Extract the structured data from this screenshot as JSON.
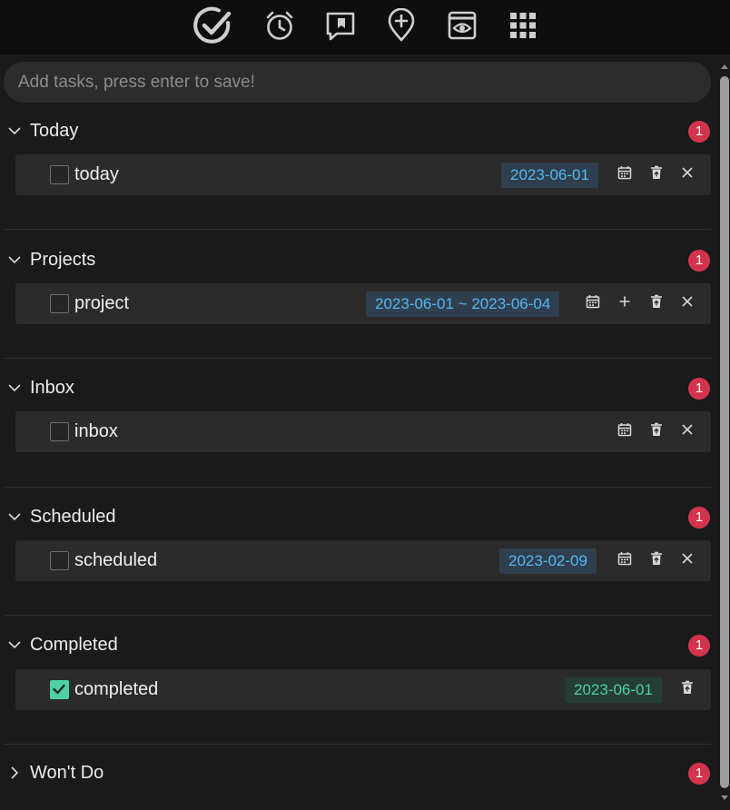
{
  "toolbar": {
    "icons": [
      "check-circle-icon",
      "alarm-clock-icon",
      "bookmark-message-icon",
      "map-pin-plus-icon",
      "eye-window-icon",
      "grid-apps-icon"
    ]
  },
  "input": {
    "placeholder": "Add tasks, press enter to save!",
    "value": ""
  },
  "colors": {
    "badge": "#d3344d",
    "date_blue": "#56b8f0",
    "date_green": "#4fd1a5",
    "checked": "#4fd1a5"
  },
  "sections": [
    {
      "title": "Today",
      "count": "1",
      "expanded": true,
      "task": {
        "text": "today",
        "date": "2023-06-01",
        "checked": false,
        "actions": [
          "calendar-icon",
          "trash-icon",
          "close-icon"
        ]
      }
    },
    {
      "title": "Projects",
      "count": "1",
      "expanded": true,
      "task": {
        "text": "project",
        "date": "2023-06-01 ~ 2023-06-04",
        "checked": false,
        "actions": [
          "calendar-icon",
          "plus-icon",
          "trash-icon",
          "close-icon"
        ]
      }
    },
    {
      "title": "Inbox",
      "count": "1",
      "expanded": true,
      "task": {
        "text": "inbox",
        "date": "",
        "checked": false,
        "actions": [
          "calendar-icon",
          "trash-icon",
          "close-icon"
        ]
      }
    },
    {
      "title": "Scheduled",
      "count": "1",
      "expanded": true,
      "task": {
        "text": "scheduled",
        "date": "2023-02-09",
        "checked": false,
        "actions": [
          "calendar-icon",
          "trash-icon",
          "close-icon"
        ]
      }
    },
    {
      "title": "Completed",
      "count": "1",
      "expanded": true,
      "task": {
        "text": "completed",
        "date": "2023-06-01",
        "checked": true,
        "actions": [
          "trash-icon"
        ]
      }
    },
    {
      "title": "Won't Do",
      "count": "1",
      "expanded": false
    }
  ]
}
